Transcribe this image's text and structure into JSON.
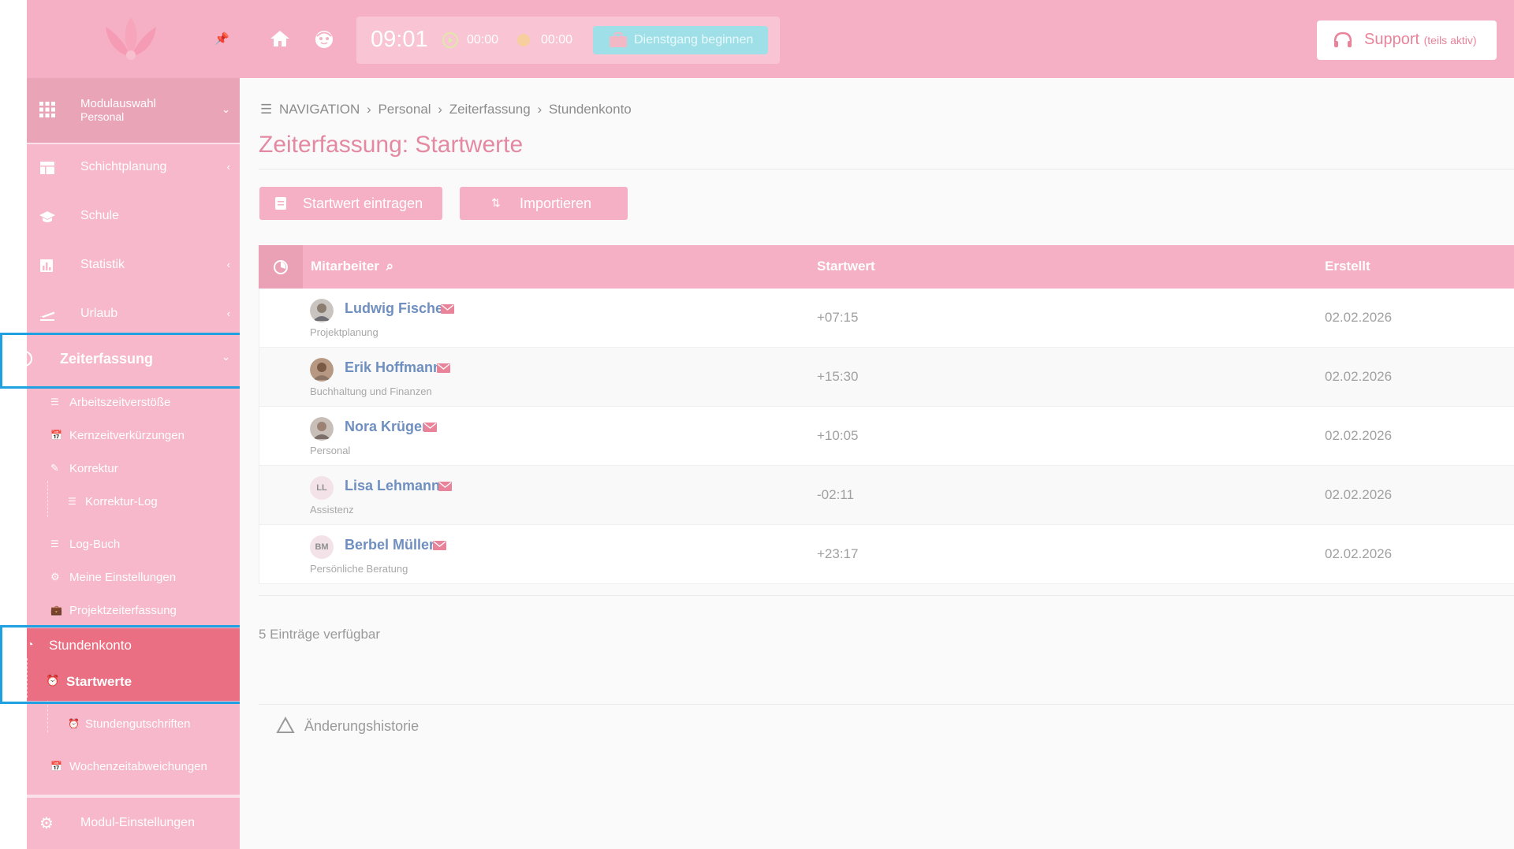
{
  "sidebar": {
    "module": {
      "title": "Modulauswahl",
      "subtitle": "Personal"
    },
    "items": [
      {
        "label": "Schichtplanung"
      },
      {
        "label": "Schule"
      },
      {
        "label": "Statistik"
      },
      {
        "label": "Urlaub"
      },
      {
        "label": "Zeiterfassung"
      }
    ],
    "subitems": {
      "arbeitszeit": "Arbeitszeitverstöße",
      "kernzeit": "Kernzeitverkürzungen",
      "korrektur": "Korrektur",
      "korrektur_log": "Korrektur-Log",
      "logbuch": "Log-Buch",
      "einstellungen": "Meine Einstellungen",
      "projekt": "Projektzeiterfassung",
      "stundenkonto": "Stundenkonto",
      "startwerte": "Startwerte",
      "gutschriften": "Stundengutschriften",
      "wochenzeit": "Wochenzeitabweichungen"
    },
    "bottom": "Modul-Einstellungen"
  },
  "topbar": {
    "time": "09:01",
    "timer1": "00:00",
    "timer2": "00:00",
    "dienstgang": "Dienstgang beginnen",
    "support": "Support",
    "support_note": "(teils aktiv)"
  },
  "main": {
    "breadcrumb": [
      "NAVIGATION",
      "Personal",
      "Zeiterfassung",
      "Stundenkonto"
    ],
    "title": "Zeiterfassung: Startwerte",
    "buttons": {
      "add": "Startwert eintragen",
      "import": "Importieren"
    },
    "table": {
      "headers": {
        "employee": "Mitarbeiter",
        "start": "Startwert",
        "created": "Erstellt"
      },
      "rows": [
        {
          "name": "Ludwig Fischer",
          "dept": "Projektplanung",
          "start": "+07:15",
          "created": "02.02.2026",
          "initials": ""
        },
        {
          "name": "Erik Hoffmann",
          "dept": "Buchhaltung und Finanzen",
          "start": "+15:30",
          "created": "02.02.2026",
          "initials": ""
        },
        {
          "name": "Nora Krüger",
          "dept": "Personal",
          "start": "+10:05",
          "created": "02.02.2026",
          "initials": ""
        },
        {
          "name": "Lisa Lehmann",
          "dept": "Assistenz",
          "start": "-02:11",
          "created": "02.02.2026",
          "initials": "LL"
        },
        {
          "name": "Berbel Müller",
          "dept": "Persönliche Beratung",
          "start": "+23:17",
          "created": "02.02.2026",
          "initials": "BM"
        }
      ]
    },
    "entries": "5 Einträge verfügbar",
    "history": "Änderungshistorie"
  },
  "colors": {
    "accent": "#f6b0c5",
    "active": "#ea6f82",
    "highlight": "#1fa0e0",
    "link": "#6f8fc0"
  }
}
